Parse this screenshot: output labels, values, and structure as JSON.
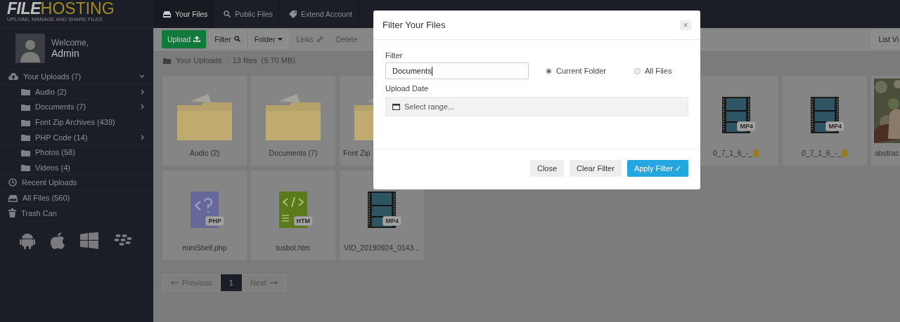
{
  "logo": {
    "brand_first": "FILE",
    "brand_second": "HOSTING",
    "tagline": "UPLOAD, MANAGE AND SHARE FILES"
  },
  "nav": {
    "tabs": [
      {
        "label": "Your Files",
        "selected": true
      },
      {
        "label": "Public Files",
        "selected": false
      },
      {
        "label": "Extend Account",
        "selected": false
      }
    ]
  },
  "user": {
    "greeting": "Welcome,",
    "name": "Admin"
  },
  "sidebar": {
    "items": [
      {
        "kind": "cloud",
        "label": "Your Uploads (7)",
        "expanded": true,
        "children": [
          {
            "kind": "folder",
            "label": "Audio (2)",
            "expanded": false
          },
          {
            "kind": "folder",
            "label": "Documents (7)",
            "expanded": false
          },
          {
            "kind": "folder",
            "label": "Font Zip Archives (439)"
          },
          {
            "kind": "folder",
            "label": "PHP Code (14)",
            "expanded": false
          },
          {
            "kind": "folder",
            "label": "Photos (58)"
          },
          {
            "kind": "folder",
            "label": "Videos (4)"
          }
        ]
      },
      {
        "kind": "clock",
        "label": "Recent Uploads"
      },
      {
        "kind": "drive",
        "label": "All Files (560)"
      },
      {
        "kind": "trash",
        "label": "Trash Can"
      }
    ]
  },
  "toolbar": {
    "buttons": [
      {
        "kind": "primary",
        "label": "Upload"
      },
      {
        "kind": "default",
        "label": "Filter"
      },
      {
        "kind": "default",
        "label": "Folder"
      },
      {
        "kind": "link",
        "label": "Links"
      },
      {
        "kind": "link",
        "label": "Delete"
      }
    ],
    "view_button": "List Vi"
  },
  "breadcrumb": {
    "folder": "Your Uploads",
    "summary": "13 files  (9.70 MB)"
  },
  "files": {
    "rows": [
      [
        {
          "kind": "folder",
          "name": "Audio (2)"
        },
        {
          "kind": "folder",
          "name": "Documents (7)"
        },
        {
          "kind": "folder",
          "name": "Font Zip",
          "clipped": true
        },
        {
          "kind": "mp4",
          "name": "0_7_1_6_-_",
          "badge": "MP4"
        },
        {
          "kind": "mp4",
          "name": "0_7_1_6_-_",
          "badge": "MP4"
        },
        {
          "kind": "picture",
          "name": "abstrac",
          "clipped": true
        }
      ],
      [
        {
          "kind": "php",
          "name": "miniShell.php",
          "badge": "PHP"
        },
        {
          "kind": "htm",
          "name": "tusbol.htm",
          "badge": "HTM"
        },
        {
          "kind": "mp4",
          "name": "VID_20190924_0143...",
          "badge": "MP4"
        }
      ]
    ]
  },
  "pagination": {
    "previous": "Previous",
    "next": "Next",
    "pages": [
      {
        "label": "1",
        "selected": true
      }
    ]
  },
  "filter_modal": {
    "title": "Filter Your Files",
    "close": "×",
    "filter_label": "Filter",
    "filter_value": "Documents",
    "scope_options": [
      {
        "label": "Current Folder",
        "selected": true
      },
      {
        "label": "All Files",
        "selected": false
      }
    ],
    "date_label": "Upload Date",
    "date_placeholder": "Select range...",
    "buttons": [
      {
        "kind": "default",
        "label": "Close"
      },
      {
        "kind": "default",
        "label": "Clear Filter"
      },
      {
        "kind": "primary",
        "label": "Apply Filter",
        "check": "✓"
      }
    ]
  }
}
